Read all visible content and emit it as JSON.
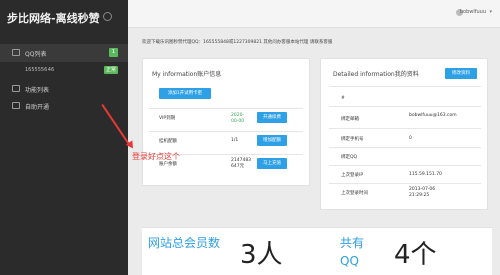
{
  "sidebar": {
    "brand": "步比网络-离线秒赞",
    "items": [
      {
        "label": "QQ列表",
        "badge": "1",
        "badge_color": "#5cb85c"
      },
      {
        "label": "1655556&#92;6",
        "badge": "正常",
        "badge_color": "#5cb85c"
      },
      {
        "label": "功能列表",
        "badge": ""
      },
      {
        "label": "自助开通",
        "badge": ""
      }
    ]
  },
  "topbar": {
    "username": "bobwlfuuu",
    "caret": "▾"
  },
  "notice": "欢迎下载乐讯图秒赞代理QQ：165555848或1227309821 其他问办客服本站代理 请联系客服",
  "account_panel": {
    "title": "My information账户信息",
    "add_button": "添加1开试用卡密",
    "rows": [
      {
        "label": "VIP到期",
        "value": "2020-00-00",
        "button": "开通续费"
      },
      {
        "label": "挂机配额",
        "value": "1/1",
        "button": "增加配额"
      },
      {
        "label": "账户余额",
        "value": "2147483647元",
        "button": "马上充值"
      }
    ]
  },
  "detail_panel": {
    "title": "Detailed information我的资料",
    "edit_button": "修改资料",
    "hash": "#",
    "rows": [
      {
        "label": "绑定邮箱",
        "value": "bobwlfuuu@163.com"
      },
      {
        "label": "绑定手机号",
        "value": "0"
      },
      {
        "label": "绑定QQ",
        "value": ""
      },
      {
        "label": "上次登录IP",
        "value": "115.59.151.70"
      },
      {
        "label": "上次登录时间",
        "value": "2013-07-06 21:29:25"
      }
    ]
  },
  "stats": {
    "members_label": "网站总会员数",
    "members_value": "3人",
    "qq_label": "共有QQ",
    "qq_value": "4个"
  },
  "annotation": "登录好点这个",
  "colors": {
    "accent": "#2ea0e6",
    "annotation": "#e53935",
    "sidebar_bg": "#2b2b2b"
  }
}
